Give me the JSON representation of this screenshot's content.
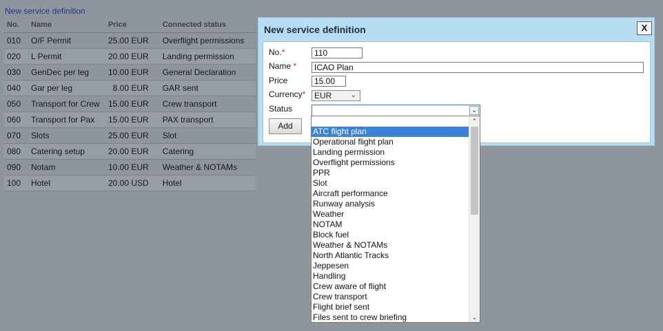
{
  "page": {
    "link": "New service definition",
    "table": {
      "headers": [
        "No.",
        "Name",
        "Price",
        "Connected status"
      ],
      "rows": [
        [
          "010",
          "O/F Permit",
          "25.00 EUR",
          "Overflight permissions"
        ],
        [
          "020",
          "L Permit",
          "20.00 EUR",
          "Landing permission"
        ],
        [
          "030",
          "GenDec per leg",
          "10.00 EUR",
          "General Declaration"
        ],
        [
          "040",
          "Gar per leg",
          "8.00 EUR",
          "GAR sent"
        ],
        [
          "050",
          "Transport for Crew",
          "15.00 EUR",
          "Crew transport"
        ],
        [
          "060",
          "Transport for Pax",
          "15.00 EUR",
          "PAX transport"
        ],
        [
          "070",
          "Slots",
          "25.00 EUR",
          "Slot"
        ],
        [
          "080",
          "Catering setup",
          "20.00 EUR",
          "Catering"
        ],
        [
          "090",
          "Notam",
          "10.00 EUR",
          "Weather & NOTAMs"
        ],
        [
          "100",
          "Hotel",
          "20.00 USD",
          "Hotel"
        ]
      ]
    }
  },
  "modal": {
    "title": "New service definition",
    "close_label": "X",
    "fields": {
      "no_label": "No.",
      "no_value": "110",
      "name_label": "Name",
      "name_value": "ICAO Plan",
      "price_label": "Price",
      "price_value": "15.00",
      "currency_label": "Currency",
      "currency_value": "EUR",
      "status_label": "Status",
      "status_value": "",
      "required_mark": "*"
    },
    "add_label": "Add"
  },
  "dropdown": {
    "options": [
      "ATC flight plan",
      "Operational flight plan",
      "Landing permission",
      "Overflight permissions",
      "PPR",
      "Slot",
      "Aircraft performance",
      "Runway analysis",
      "Weather",
      "NOTAM",
      "Block fuel",
      "Weather & NOTAMs",
      "North Atlantic Tracks",
      "Jeppesen",
      "Handling",
      "Crew aware of flight",
      "Crew transport",
      "Flight brief sent",
      "Files sent to crew briefing"
    ],
    "highlighted": "ATC flight plan"
  },
  "icons": {
    "close": "close-icon",
    "chevron": "chevron-down-icon",
    "scroll_up": "scroll-up-icon",
    "scroll_down": "scroll-down-icon"
  },
  "colors": {
    "overlay": "#8e959d",
    "modal_bg": "#b6ddf2",
    "highlight": "#3c82d8",
    "required": "#d4182b",
    "link": "#1f3a86"
  }
}
